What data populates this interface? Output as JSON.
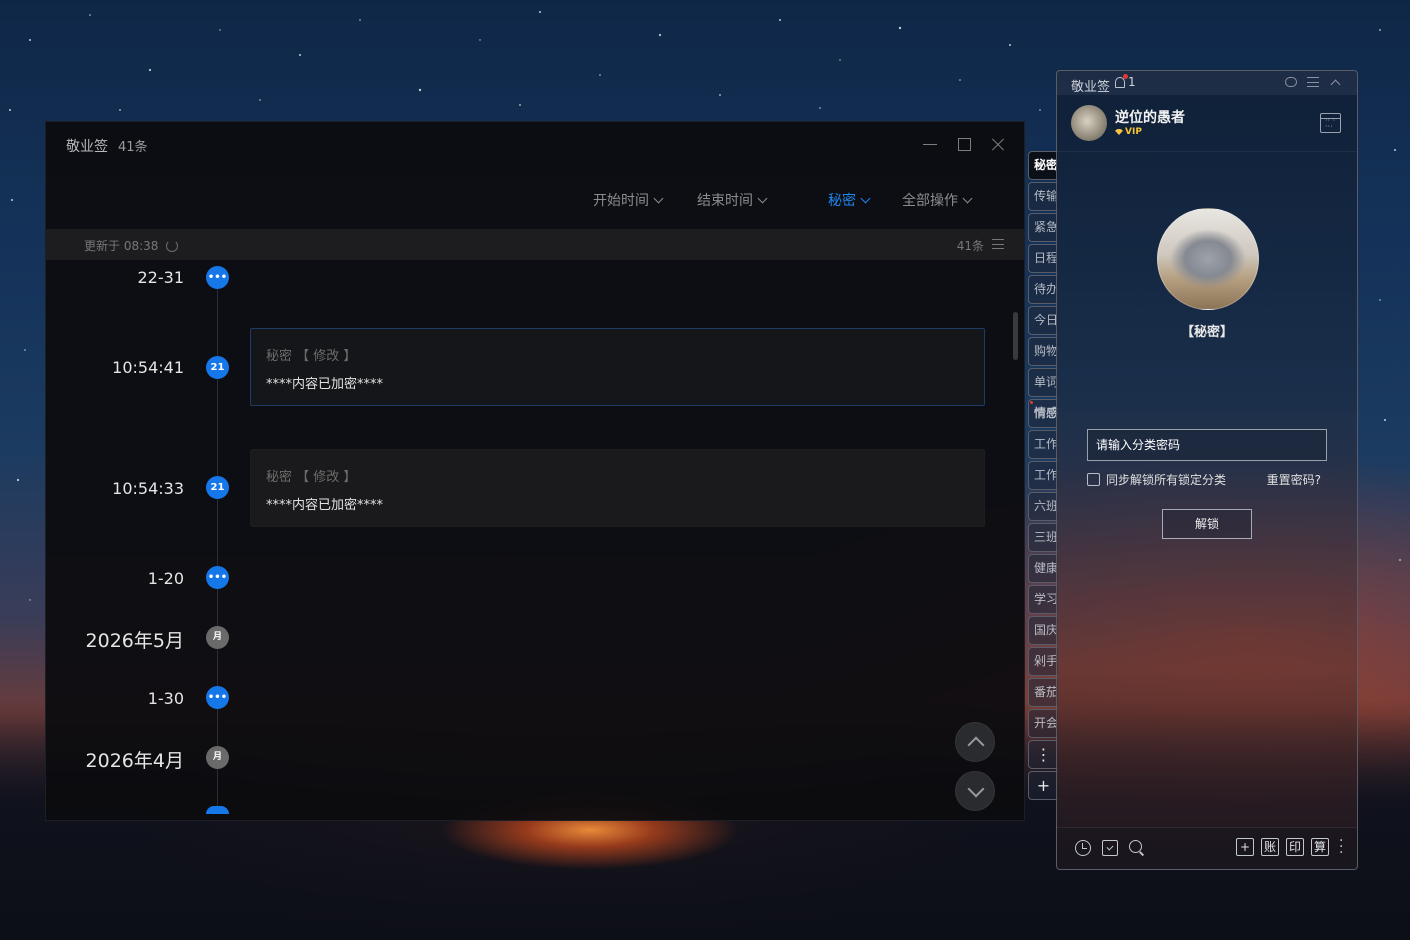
{
  "main_window": {
    "app_name": "敬业签",
    "count_label": "41条",
    "filters": {
      "start_time": "开始时间",
      "end_time": "结束时间",
      "category": "秘密",
      "all_ops": "全部操作"
    },
    "status": {
      "updated": "更新于 08:38",
      "total": "41条"
    },
    "timeline": [
      {
        "label": "22-31",
        "badge": "•••",
        "type": "range"
      },
      {
        "label": "10:54:41",
        "badge": "21",
        "type": "entry",
        "meta": "秘密 【 修改 】",
        "body": "****内容已加密****",
        "selected": true
      },
      {
        "label": "10:54:33",
        "badge": "21",
        "type": "entry",
        "meta": "秘密 【 修改 】",
        "body": "****内容已加密****",
        "selected": false
      },
      {
        "label": "1-20",
        "badge": "•••",
        "type": "range"
      },
      {
        "label": "2026年5月",
        "badge": "月",
        "type": "month"
      },
      {
        "label": "1-30",
        "badge": "•••",
        "type": "range"
      },
      {
        "label": "2026年4月",
        "badge": "月",
        "type": "month"
      }
    ]
  },
  "side_panel": {
    "app_name": "敬业签",
    "notification_count": "1",
    "user": {
      "name": "逆位的愚者",
      "badge": "VIP"
    },
    "lock": {
      "category_label": "【秘密】",
      "password_placeholder": "请输入分类密码",
      "sync_unlock": "同步解锁所有锁定分类",
      "reset_password": "重置密码?",
      "unlock_button": "解锁"
    },
    "tabs": [
      "秘密",
      "传输",
      "紧急",
      "日程",
      "待办",
      "今日",
      "购物",
      "单词",
      "情感",
      "工作",
      "工作",
      "六班",
      "三班",
      "健康",
      "学习",
      "国庆",
      "剁手",
      "番茄",
      "开会",
      "⋮",
      "+"
    ],
    "bottom_tools": [
      "+",
      "账",
      "印",
      "算"
    ]
  }
}
